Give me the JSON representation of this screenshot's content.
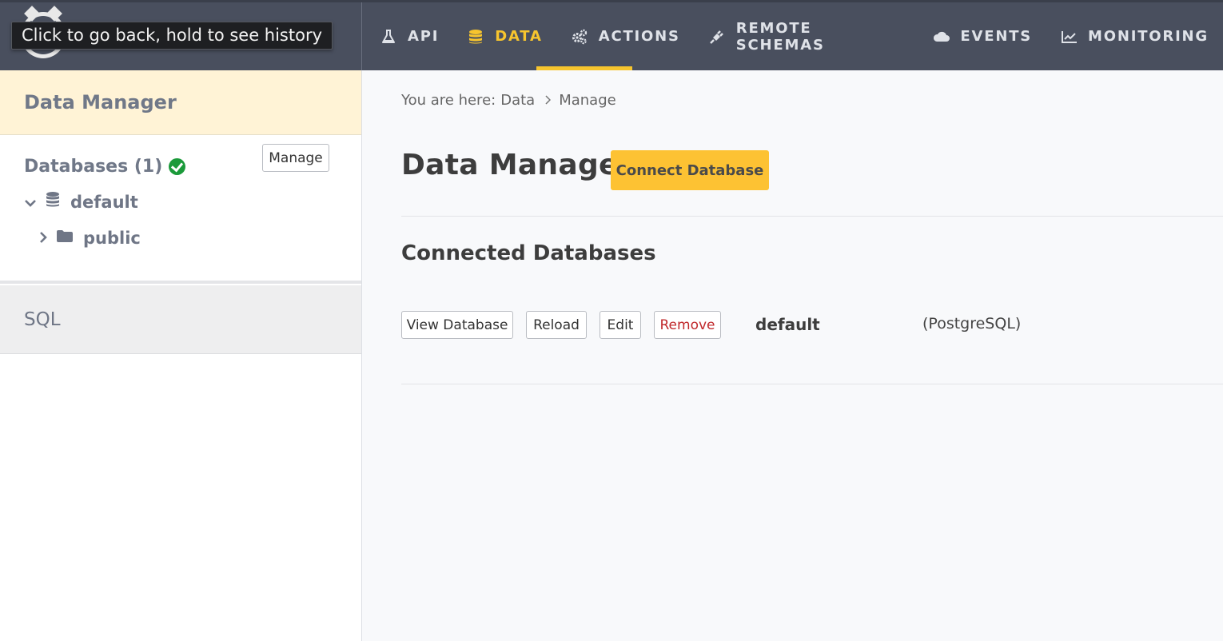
{
  "tooltip": {
    "text": "Click to go back, hold to see history"
  },
  "nav": {
    "items": [
      {
        "label": "API",
        "icon": "flask-icon"
      },
      {
        "label": "DATA",
        "icon": "database-icon",
        "active": true
      },
      {
        "label": "ACTIONS",
        "icon": "gears-icon"
      },
      {
        "label": "REMOTE SCHEMAS",
        "icon": "plug-icon"
      },
      {
        "label": "EVENTS",
        "icon": "cloud-icon"
      },
      {
        "label": "MONITORING",
        "icon": "chart-line-icon"
      }
    ],
    "accent": "#f7c52e"
  },
  "sidebar": {
    "header": "Data Manager",
    "databases_title": "Databases (1)",
    "manage_label": "Manage",
    "tree": {
      "db": "default",
      "schema": "public"
    },
    "sql_label": "SQL"
  },
  "main": {
    "breadcrumb": {
      "prefix": "You are here:",
      "items": [
        "Data",
        "Manage"
      ]
    },
    "title": "Data Manager",
    "connect_label": "Connect Database",
    "section_title": "Connected Databases",
    "databases": [
      {
        "view_label": "View Database",
        "reload_label": "Reload",
        "edit_label": "Edit",
        "remove_label": "Remove",
        "name": "default",
        "kind": "(PostgreSQL)"
      }
    ]
  },
  "colors": {
    "topbar": "#494f5e",
    "highlight": "#fff3d6",
    "button_yellow": "#fdc233",
    "remove_red": "#c0282b",
    "success_green": "#1b9a3a"
  }
}
